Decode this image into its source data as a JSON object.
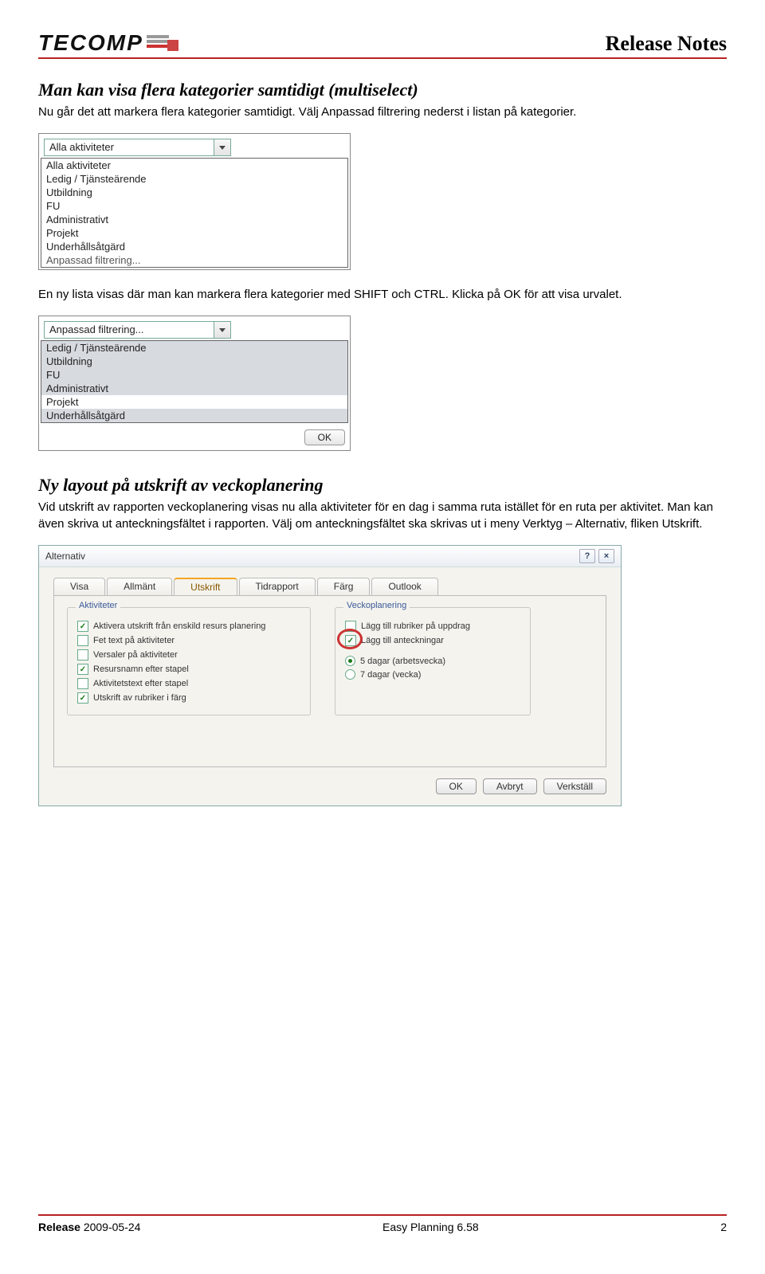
{
  "header": {
    "logo_text": "TECOMP",
    "title": "Release Notes"
  },
  "section1": {
    "heading": "Man kan visa flera kategorier samtidigt (multiselect)",
    "body": "Nu går det att markera flera kategorier samtidigt. Välj Anpassad filtrering nederst i listan på kategorier."
  },
  "shot1": {
    "combo_value": "Alla aktiviteter",
    "items": [
      "Alla aktiviteter",
      "Ledig / Tjänsteärende",
      "Utbildning",
      "FU",
      "Administrativt",
      "Projekt",
      "Underhållsåtgärd",
      "Anpassad filtrering..."
    ]
  },
  "para2": "En ny lista visas där man kan markera flera kategorier med SHIFT och CTRL. Klicka på OK för att visa urvalet.",
  "shot2": {
    "combo_value": "Anpassad filtrering...",
    "items": [
      "Ledig / Tjänsteärende",
      "Utbildning",
      "FU",
      "Administrativt",
      "Projekt",
      "Underhållsåtgärd"
    ],
    "ok": "OK"
  },
  "section2": {
    "heading": "Ny layout på utskrift av veckoplanering",
    "body": "Vid utskrift av rapporten veckoplanering visas nu alla aktiviteter för en dag i samma ruta istället för en ruta per aktivitet. Man kan även skriva ut anteckningsfältet i rapporten. Välj om anteckningsfältet ska skrivas ut i meny Verktyg – Alternativ, fliken Utskrift."
  },
  "dialog": {
    "title": "Alternativ",
    "help": "?",
    "close": "×",
    "tabs": [
      "Visa",
      "Allmänt",
      "Utskrift",
      "Tidrapport",
      "Färg",
      "Outlook"
    ],
    "active_tab": 2,
    "group1": {
      "title": "Aktiviteter",
      "options": [
        {
          "label": "Aktivera utskrift från enskild resurs planering",
          "checked": true
        },
        {
          "label": "Fet text på aktiviteter",
          "checked": false
        },
        {
          "label": "Versaler på aktiviteter",
          "checked": false
        },
        {
          "label": "Resursnamn efter stapel",
          "checked": true
        },
        {
          "label": "Aktivitetstext efter stapel",
          "checked": false
        },
        {
          "label": "Utskrift av rubriker i färg",
          "checked": true
        }
      ]
    },
    "group2": {
      "title": "Veckoplanering",
      "checks": [
        {
          "label": "Lägg till rubriker på uppdrag",
          "checked": false
        },
        {
          "label": "Lägg till anteckningar",
          "checked": true
        }
      ],
      "radios": [
        {
          "label": "5 dagar (arbetsvecka)",
          "on": true
        },
        {
          "label": "7 dagar (vecka)",
          "on": false
        }
      ]
    },
    "buttons": {
      "ok": "OK",
      "cancel": "Avbryt",
      "apply": "Verkställ"
    }
  },
  "footer": {
    "release_label": "Release",
    "release_date": "2009-05-24",
    "product": "Easy Planning 6.58",
    "page": "2"
  }
}
